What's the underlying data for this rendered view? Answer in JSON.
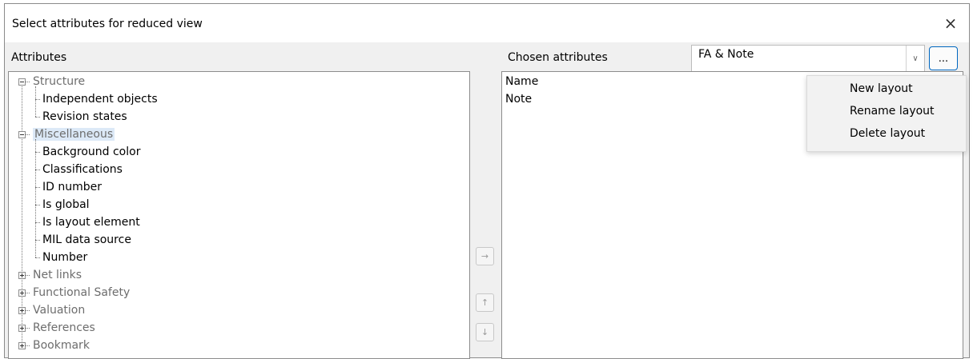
{
  "dialog": {
    "title": "Select attributes for reduced view",
    "close_icon": "×"
  },
  "attributes": {
    "label": "Attributes",
    "tree": [
      {
        "label": "Structure",
        "expanded": true,
        "children": [
          "Independent objects",
          "Revision states"
        ]
      },
      {
        "label": "Miscellaneous",
        "expanded": true,
        "selected": true,
        "children": [
          "Background color",
          "Classifications",
          "ID number",
          "Is global",
          "Is layout element",
          "MIL data source",
          "Number"
        ]
      },
      {
        "label": "Net links",
        "expanded": false,
        "children": []
      },
      {
        "label": "Functional Safety",
        "expanded": false,
        "children": []
      },
      {
        "label": "Valuation",
        "expanded": false,
        "children": []
      },
      {
        "label": "References",
        "expanded": false,
        "children": []
      },
      {
        "label": "Bookmark",
        "expanded": false,
        "children": []
      }
    ]
  },
  "side_buttons": {
    "add_icon": "→",
    "up_icon": "↑",
    "down_icon": "↓"
  },
  "chosen": {
    "label": "Chosen attributes",
    "layout_value": "FA & Note",
    "items": [
      "Name",
      "Note"
    ]
  },
  "layout_controls": {
    "dropdown_icon": "∨",
    "more_label": "..."
  },
  "layout_menu": {
    "items": [
      "New layout",
      "Rename layout",
      "Delete layout"
    ]
  },
  "icons": {
    "close": "close-icon",
    "add": "arrow-right-icon",
    "up": "arrow-up-icon",
    "down": "arrow-down-icon",
    "expand": "tree-expander-icon",
    "dropdown": "chevron-down-icon"
  }
}
